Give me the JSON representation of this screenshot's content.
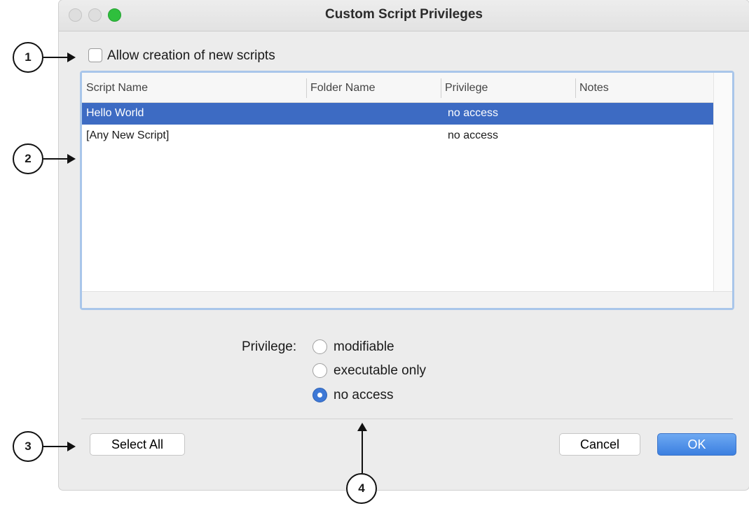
{
  "window": {
    "title": "Custom Script Privileges"
  },
  "checkbox": {
    "label": "Allow creation of new scripts",
    "checked": false
  },
  "table": {
    "columns": [
      "Script Name",
      "Folder Name",
      "Privilege",
      "Notes"
    ],
    "rows": [
      {
        "script_name": "Hello World",
        "folder_name": "",
        "privilege": "no access",
        "notes": "",
        "selected": true
      },
      {
        "script_name": "[Any New Script]",
        "folder_name": "",
        "privilege": "no access",
        "notes": "",
        "selected": false
      }
    ]
  },
  "privilege": {
    "label": "Privilege:",
    "options": [
      "modifiable",
      "executable only",
      "no access"
    ],
    "selected": "no access"
  },
  "buttons": {
    "select_all": "Select All",
    "cancel": "Cancel",
    "ok": "OK"
  },
  "callouts": [
    "1",
    "2",
    "3",
    "4"
  ]
}
